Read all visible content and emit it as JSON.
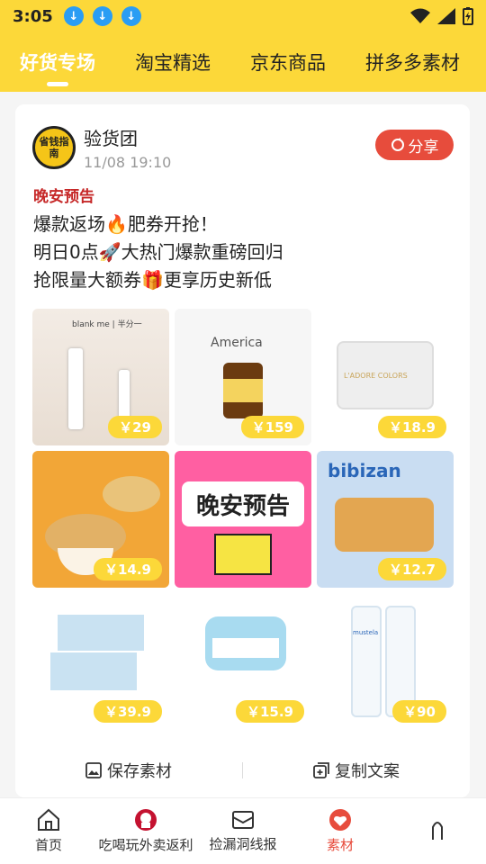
{
  "status": {
    "time": "3:05",
    "download_icons": [
      "download-icon",
      "download-icon",
      "download-icon"
    ]
  },
  "tabs": [
    {
      "label": "好货专场",
      "active": true
    },
    {
      "label": "淘宝精选",
      "active": false
    },
    {
      "label": "京东商品",
      "active": false
    },
    {
      "label": "拼多多素材",
      "active": false
    }
  ],
  "post": {
    "avatar_text": "省钱指南",
    "author": "验货团",
    "time": "11/08 19:10",
    "share_label": "分享",
    "section_title": "晚安预告",
    "lines": [
      "爆款返场🔥肥券开抢！",
      "明日0点🚀大热门爆款重磅回归",
      "抢限量大额券🎁更享历史新低"
    ],
    "products": [
      {
        "price": "￥29",
        "caption": "blank me | 半分一"
      },
      {
        "price": "￥159",
        "caption": "America"
      },
      {
        "price": "￥18.9",
        "caption": "L'ADORE COLORS"
      },
      {
        "price": "￥14.9",
        "caption": ""
      },
      {
        "price": "",
        "caption": "晚安预告"
      },
      {
        "price": "￥12.7",
        "caption": "bibizan"
      },
      {
        "price": "￥39.9",
        "caption": ""
      },
      {
        "price": "￥15.9",
        "caption": ""
      },
      {
        "price": "￥90",
        "caption": "mustela"
      }
    ],
    "save_label": "保存素材",
    "copy_label": "复制文案"
  },
  "nav": [
    {
      "label": "首页",
      "icon": "home-icon"
    },
    {
      "label": "吃喝玩外卖返利",
      "icon": "kfc-icon"
    },
    {
      "label": "捡漏洞线报",
      "icon": "envelope-icon"
    },
    {
      "label": "素材",
      "icon": "heart-icon",
      "active": true
    },
    {
      "label": "",
      "icon": "user-icon"
    }
  ]
}
